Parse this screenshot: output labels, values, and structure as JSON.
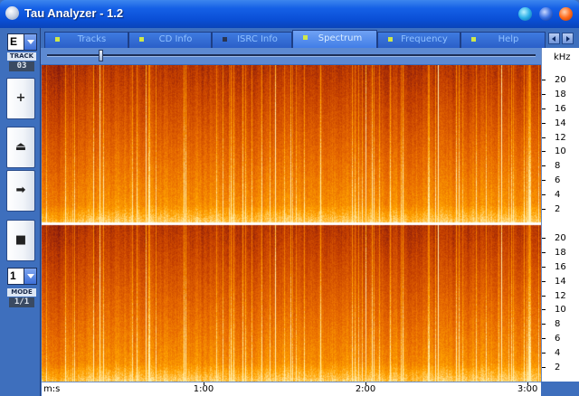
{
  "window": {
    "title": "Tau Analyzer - 1.2"
  },
  "left_panel": {
    "drive_value": "E",
    "track_caption": "TRACK",
    "track_number": "03",
    "buttons": [
      "+",
      "⏏",
      "➡",
      "■"
    ],
    "mode_value": "1",
    "mode_caption": "MODE",
    "mode_display": "1/1"
  },
  "tabs": [
    {
      "label": "Tracks",
      "active": false
    },
    {
      "label": "CD Info",
      "active": false
    },
    {
      "label": "ISRC Info",
      "active": false
    },
    {
      "label": "Spectrum",
      "active": true
    },
    {
      "label": "Frequency",
      "active": false
    },
    {
      "label": "Help",
      "active": false
    }
  ],
  "slider": {
    "position": 0.11
  },
  "chart_data": {
    "type": "heatmap",
    "panels": 2,
    "ylabel": "kHz",
    "ytick_labels": [
      "20",
      "18",
      "16",
      "14",
      "12",
      "10",
      "8",
      "6",
      "4",
      "2"
    ],
    "ylim": [
      0,
      22
    ],
    "xlabel": "m:s",
    "xtick_labels": [
      "1:00",
      "2:00",
      "3:00"
    ],
    "xlim": [
      0,
      185
    ],
    "colormap": [
      "#3a0a18",
      "#7a1410",
      "#c23d00",
      "#e86a00",
      "#ffa200",
      "#fff0b0"
    ],
    "divider_color": "#ffffff"
  }
}
